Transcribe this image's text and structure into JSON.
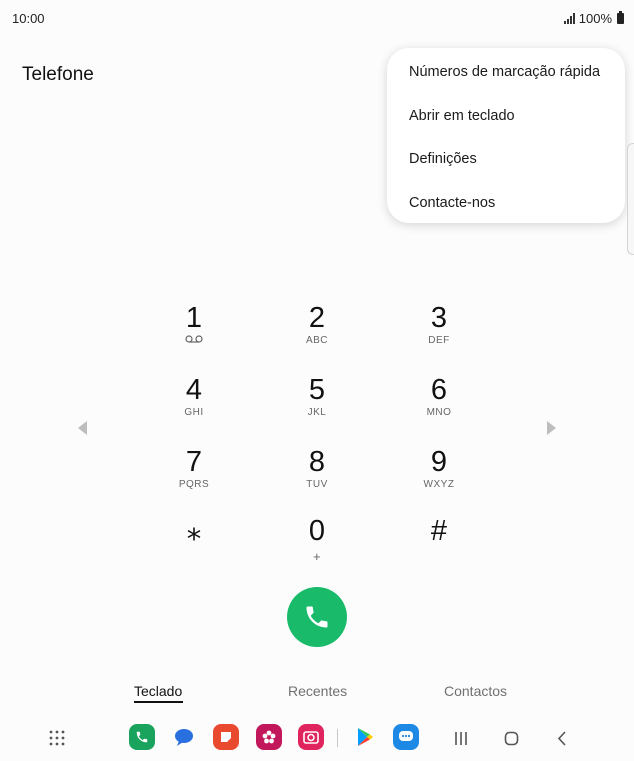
{
  "status": {
    "time": "10:00",
    "battery": "100%"
  },
  "app": {
    "title": "Telefone"
  },
  "menu": {
    "items": [
      "Números de marcação rápida",
      "Abrir em teclado",
      "Definições",
      "Contacte-nos"
    ]
  },
  "keypad": {
    "keys": [
      {
        "num": "1",
        "sub": ""
      },
      {
        "num": "2",
        "sub": "ABC"
      },
      {
        "num": "3",
        "sub": "DEF"
      },
      {
        "num": "4",
        "sub": "GHI"
      },
      {
        "num": "5",
        "sub": "JKL"
      },
      {
        "num": "6",
        "sub": "MNO"
      },
      {
        "num": "7",
        "sub": "PQRS"
      },
      {
        "num": "8",
        "sub": "TUV"
      },
      {
        "num": "9",
        "sub": "WXYZ"
      },
      {
        "num": "⁎",
        "sub": ""
      },
      {
        "num": "0",
        "sub": "+"
      },
      {
        "num": "#",
        "sub": ""
      }
    ]
  },
  "tabs": [
    "Teclado",
    "Recentes",
    "Contactos"
  ],
  "colors": {
    "call": "#1aba6b",
    "accent": "#111111"
  },
  "dock": {
    "icons": [
      "apps-grid-icon",
      "phone-app-icon",
      "messages-app-icon",
      "notes-app-icon",
      "gallery-app-icon",
      "camera-app-icon",
      "play-store-icon",
      "chat-app-icon"
    ]
  },
  "nav": {
    "icons": [
      "recents-nav-icon",
      "home-nav-icon",
      "back-nav-icon"
    ]
  }
}
